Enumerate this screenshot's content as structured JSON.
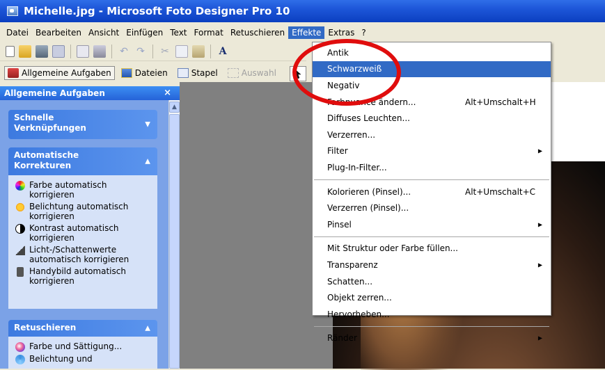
{
  "window": {
    "title": "Michelle.jpg - Microsoft Foto Designer Pro 10"
  },
  "menubar": {
    "items": [
      "Datei",
      "Bearbeiten",
      "Ansicht",
      "Einfügen",
      "Text",
      "Format",
      "Retuschieren",
      "Effekte",
      "Extras",
      "?"
    ],
    "active": "Effekte"
  },
  "task_tabs": {
    "common": "Allgemeine Aufgaben",
    "files": "Dateien",
    "batch": "Stapel",
    "selection": "Auswahl"
  },
  "panel": {
    "title": "Allgemeine Aufgaben",
    "close": "×",
    "sections": [
      {
        "title": "Schnelle Verknüpfungen",
        "expanded": false,
        "items": []
      },
      {
        "title": "Automatische Korrekturen",
        "expanded": true,
        "items": [
          "Farbe automatisch korrigieren",
          "Belichtung automatisch korrigieren",
          "Kontrast automatisch korrigieren",
          "Licht-/Schattenwerte automatisch korrigieren",
          "Handybild automatisch korrigieren"
        ]
      },
      {
        "title": "Retuschieren",
        "expanded": true,
        "items": [
          "Farbe und Sättigung...",
          "Belichtung und"
        ]
      }
    ]
  },
  "effects_menu": {
    "items": [
      {
        "label": "Antik"
      },
      {
        "label": "Schwarzweiß",
        "highlighted": true
      },
      {
        "label": "Negativ"
      },
      {
        "label": "Farbnuance ändern...",
        "shortcut": "Alt+Umschalt+H"
      },
      {
        "label": "Diffuses Leuchten..."
      },
      {
        "label": "Verzerren..."
      },
      {
        "label": "Filter",
        "submenu": true
      },
      {
        "label": "Plug-In-Filter..."
      },
      {
        "separator": true
      },
      {
        "label": "Kolorieren (Pinsel)...",
        "shortcut": "Alt+Umschalt+C"
      },
      {
        "label": "Verzerren (Pinsel)..."
      },
      {
        "label": "Pinsel",
        "submenu": true
      },
      {
        "separator": true
      },
      {
        "label": "Mit Struktur oder Farbe füllen..."
      },
      {
        "label": "Transparenz",
        "submenu": true
      },
      {
        "label": "Schatten..."
      },
      {
        "label": "Objekt zerren..."
      },
      {
        "label": "Hervorheben..."
      },
      {
        "separator": true
      },
      {
        "label": "Ränder",
        "submenu": true
      }
    ]
  },
  "colors": {
    "highlight": "#316ac5",
    "titlebar": "#0b3fc0",
    "panel": "#7ba2e7",
    "annotation": "#e00d0d"
  }
}
